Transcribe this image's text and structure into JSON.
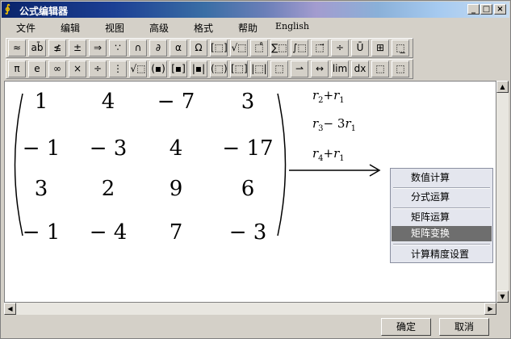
{
  "window": {
    "title": "公式编辑器",
    "icon": "formula-app-icon"
  },
  "menu": [
    "文件",
    "编辑",
    "视图",
    "高级",
    "格式",
    "帮助",
    "English"
  ],
  "toolbar1": [
    "≈",
    "ab̄",
    "≰",
    "±",
    "⇒",
    "∵",
    "∩",
    "∂",
    "α",
    "Ω",
    "[⬚]",
    "√⬚",
    "⬚̊",
    "∑⬚",
    "∫⬚",
    "⬚⃗",
    "÷",
    "Ū",
    "⊞",
    "⬚̲"
  ],
  "toolbar2": [
    "π",
    "e",
    "∞",
    "×",
    "÷",
    "⋮",
    "√⬚",
    "(▪)",
    "[▪]",
    "|▪|",
    "(⬚)",
    "[⬚]",
    "|⬚|",
    "⬚",
    "⇀",
    "↔",
    "lim",
    "dx",
    "⬚",
    "⬚"
  ],
  "matrix": [
    [
      "1",
      "4",
      "− 7",
      "3"
    ],
    [
      "− 1",
      "− 3",
      "4",
      "− 17"
    ],
    [
      "3",
      "2",
      "9",
      "6"
    ],
    [
      "− 1",
      "− 4",
      "7",
      "− 3"
    ]
  ],
  "row_ops": [
    {
      "a": "r",
      "a_sub": "2",
      "op": "+",
      "b": "r",
      "b_sub": "1"
    },
    {
      "a": "r",
      "a_sub": "3",
      "op": "− 3",
      "b": "r",
      "b_sub": "1"
    },
    {
      "a": "r",
      "a_sub": "4",
      "op": "+",
      "b": "r",
      "b_sub": "1"
    }
  ],
  "context_menu": {
    "items": [
      "数值计算",
      "分式运算",
      "矩阵运算",
      "矩阵变换",
      "计算精度设置"
    ],
    "active": "矩阵变换"
  },
  "buttons": {
    "ok": "确定",
    "cancel": "取消"
  }
}
